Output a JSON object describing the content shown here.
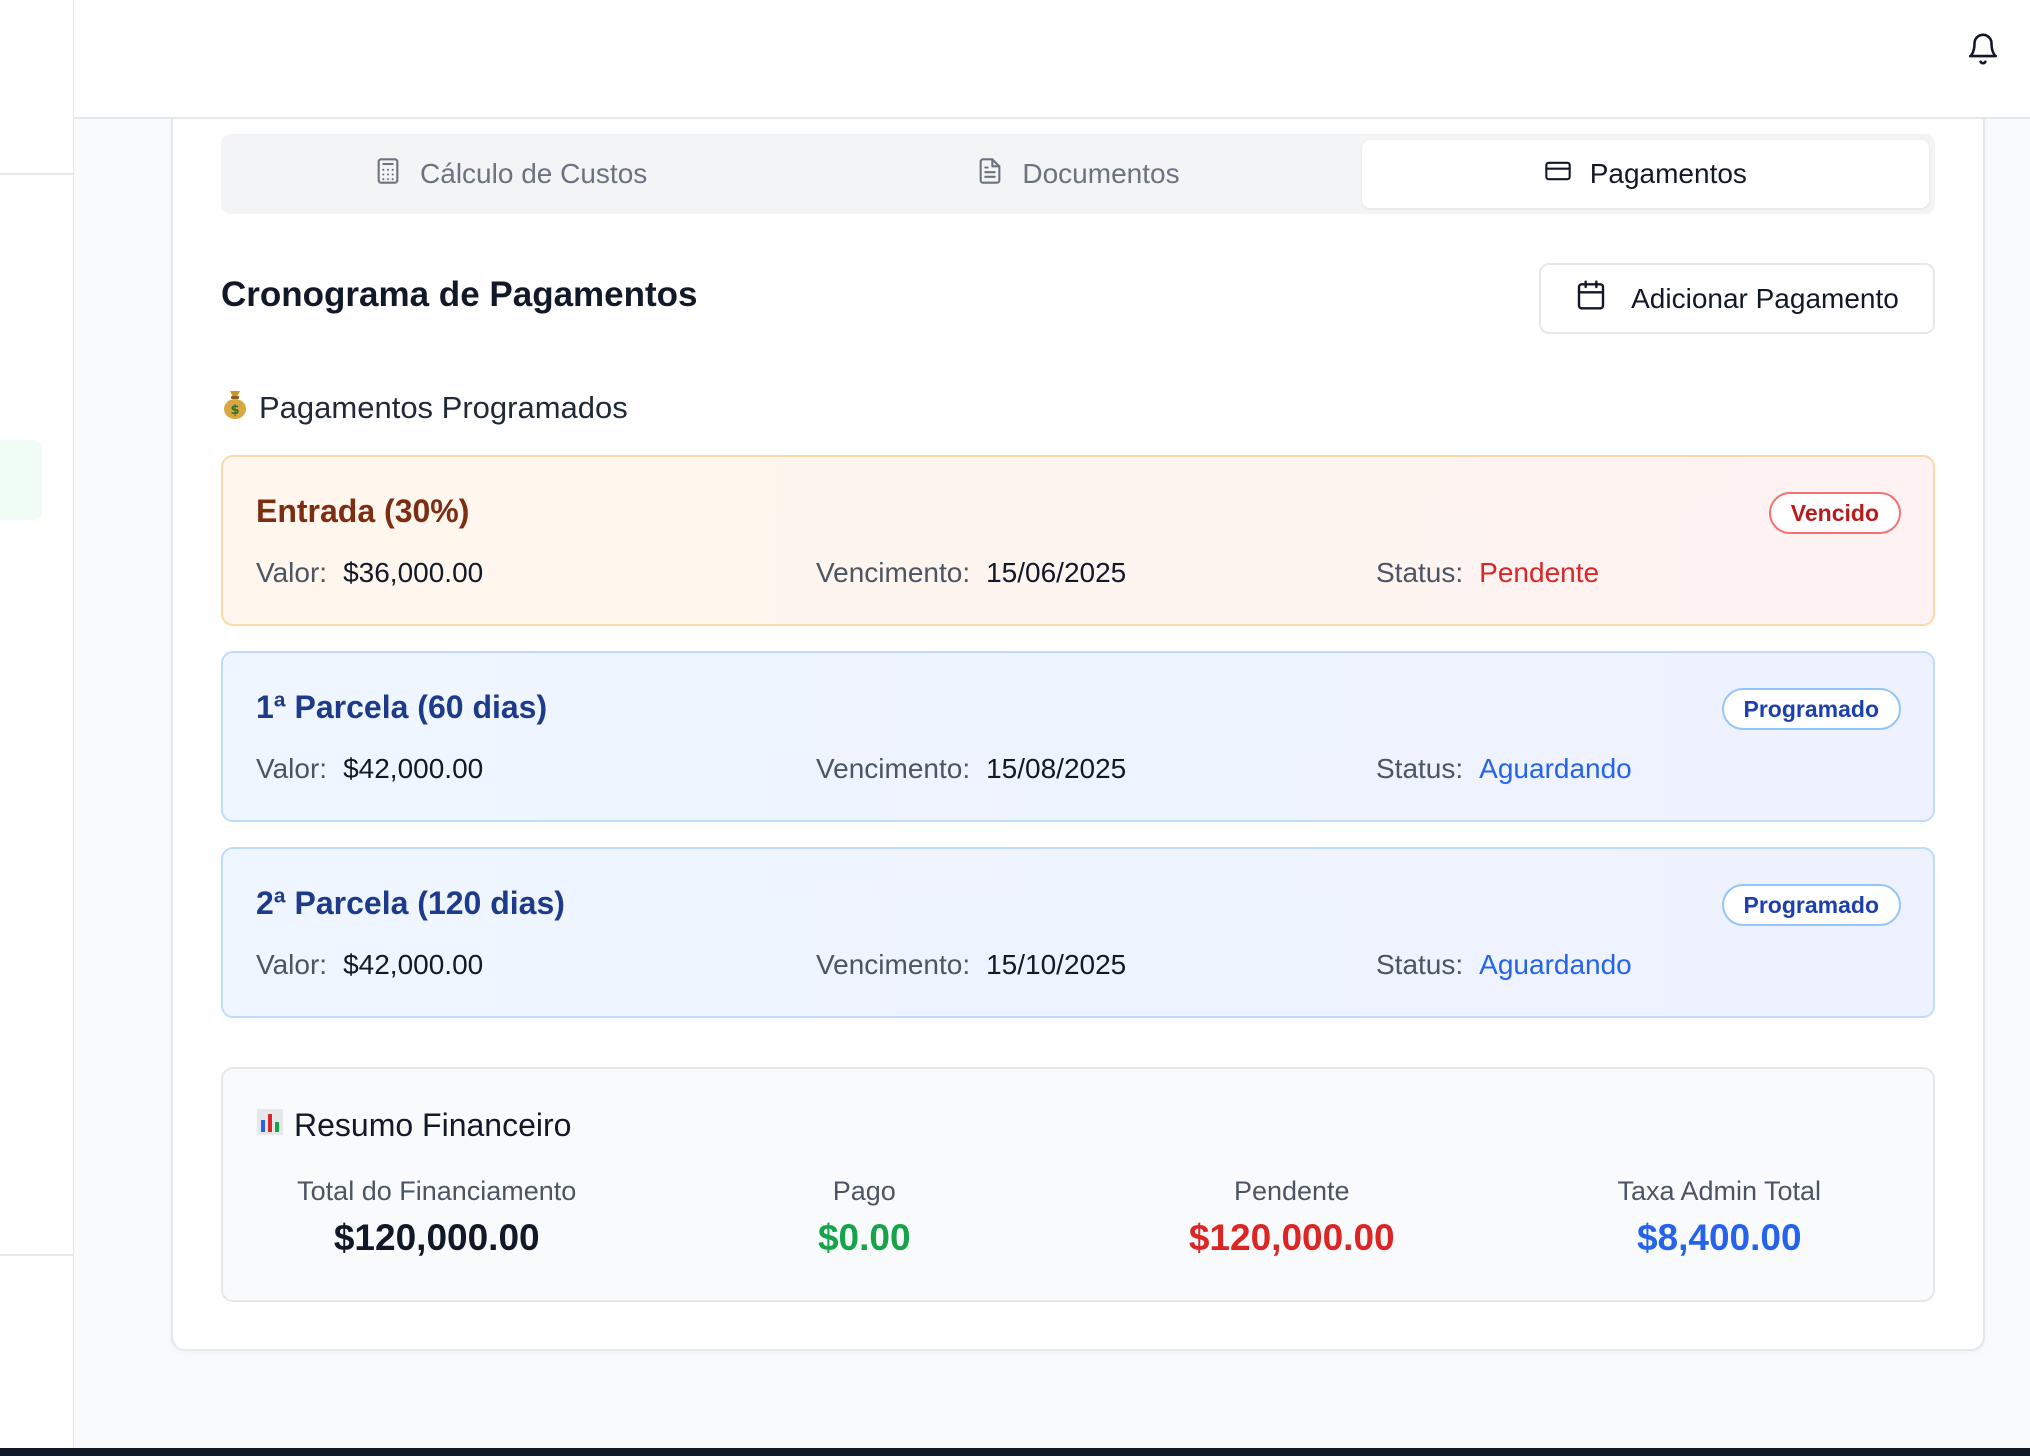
{
  "topbar": {
    "bell_icon": "bell-icon"
  },
  "tabs": [
    {
      "label": "Cálculo de Custos",
      "icon": "calculator-icon",
      "active": false
    },
    {
      "label": "Documentos",
      "icon": "document-icon",
      "active": false
    },
    {
      "label": "Pagamentos",
      "icon": "credit-card-icon",
      "active": true
    }
  ],
  "section": {
    "title": "Cronograma de Pagamentos",
    "add_button": "Adicionar Pagamento"
  },
  "scheduled": {
    "heading": "Pagamentos Programados",
    "items": [
      {
        "title": "Entrada (30%)",
        "badge": "Vencido",
        "value_label": "Valor:",
        "value": "$36,000.00",
        "due_label": "Vencimento:",
        "due": "15/06/2025",
        "status_label": "Status:",
        "status": "Pendente"
      },
      {
        "title": "1ª Parcela (60 dias)",
        "badge": "Programado",
        "value_label": "Valor:",
        "value": "$42,000.00",
        "due_label": "Vencimento:",
        "due": "15/08/2025",
        "status_label": "Status:",
        "status": "Aguardando"
      },
      {
        "title": "2ª Parcela (120 dias)",
        "badge": "Programado",
        "value_label": "Valor:",
        "value": "$42,000.00",
        "due_label": "Vencimento:",
        "due": "15/10/2025",
        "status_label": "Status:",
        "status": "Aguardando"
      }
    ]
  },
  "summary": {
    "heading": "Resumo Financeiro",
    "stats": [
      {
        "label": "Total do Financiamento",
        "value": "$120,000.00"
      },
      {
        "label": "Pago",
        "value": "$0.00"
      },
      {
        "label": "Pendente",
        "value": "$120,000.00"
      },
      {
        "label": "Taxa Admin Total",
        "value": "$8,400.00"
      }
    ]
  },
  "colors": {
    "overdue_text": "#dc2626",
    "scheduled_text": "#2563eb",
    "paid": "#16a34a"
  }
}
